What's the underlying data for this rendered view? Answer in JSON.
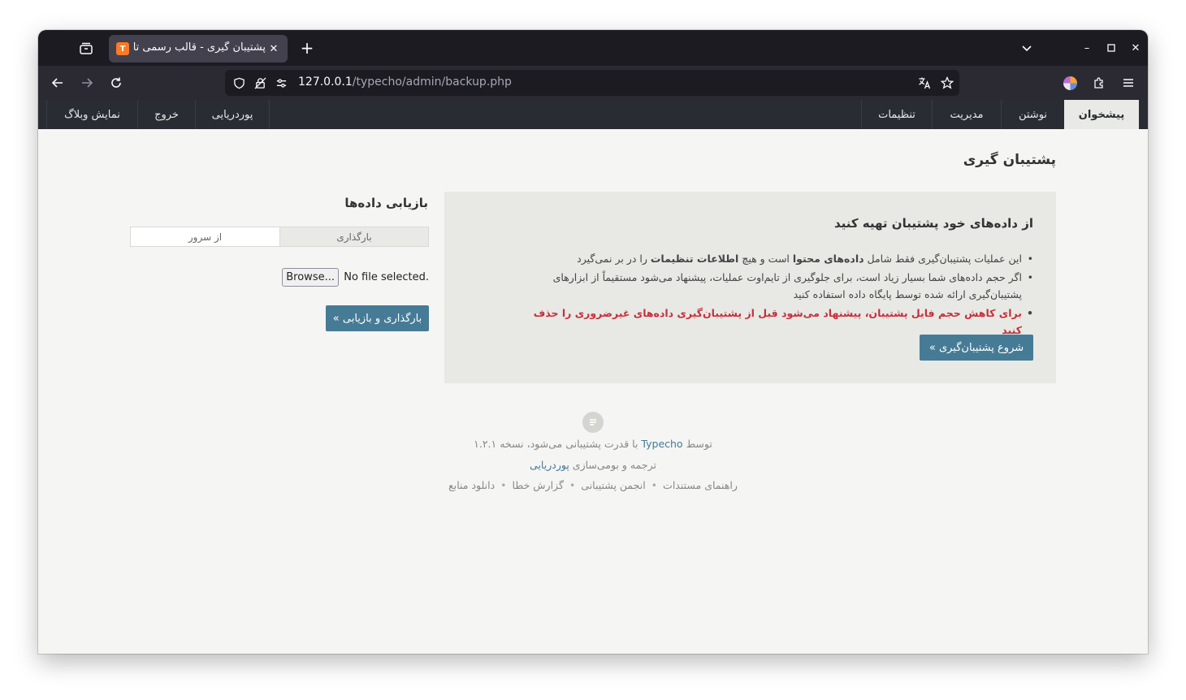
{
  "browser": {
    "tab_title": "پشتیبان گیری - قالب رسمی تا",
    "tab_favicon": "typecho-favicon",
    "url_host": "127.0.0.1",
    "url_path": "/typecho/admin/backup.php"
  },
  "admin_menu": {
    "right": [
      "پیشخوان",
      "نوشتن",
      "مدیریت",
      "تنظیمات"
    ],
    "left": [
      "پوردریایی",
      "خروج",
      "نمایش وبلاگ"
    ]
  },
  "page": {
    "title": "پشتیبان گیری",
    "backup": {
      "heading": "از داده‌های خود پشتیبان تهیه کنید",
      "item1_pre": "این عملیات پشتیبان‌گیری فقط شامل",
      "item1_bold1": "داده‌های محتوا",
      "item1_mid": "است و هیچ",
      "item1_bold2": "اطلاعات تنظیمات",
      "item1_post": "را در بر نمی‌گیرد",
      "item2": "اگر حجم داده‌های شما بسیار زیاد است، برای جلوگیری از تایم‌اوت عملیات، پیشنهاد می‌شود مستقیماً از ابزارهای پشتیبان‌گیری ارائه شده توسط پایگاه داده استفاده کنید",
      "item3": "برای کاهش حجم فایل پشتیبان، پیشنهاد می‌شود قبل از پشتیبان‌گیری داده‌های غیرضروری را حذف کنید",
      "button": "شروع پشتیبان‌گیری »"
    },
    "restore": {
      "heading": "بازیابی داده‌ها",
      "tab_upload": "بارگذاری",
      "tab_server": "از سرور",
      "browse_label": "Browse...",
      "no_file": "No file selected.",
      "button": "بارگذاری و بازیابی »"
    }
  },
  "footer": {
    "powered_pre": "توسط",
    "powered_link": "Typecho",
    "powered_post": "با قدرت پشتیبانی می‌شود، نسخه ۱.۲.۱",
    "translation_pre": "ترجمه و بومی‌سازی",
    "translation_link": "پوردریایی",
    "links": [
      "راهنمای مستندات",
      "انجمن پشتیبانی",
      "گزارش خطا",
      "دانلود منابع"
    ]
  },
  "colors": {
    "accent": "#467b96",
    "warning": "#c5303a",
    "admin_bar": "#292d33"
  }
}
